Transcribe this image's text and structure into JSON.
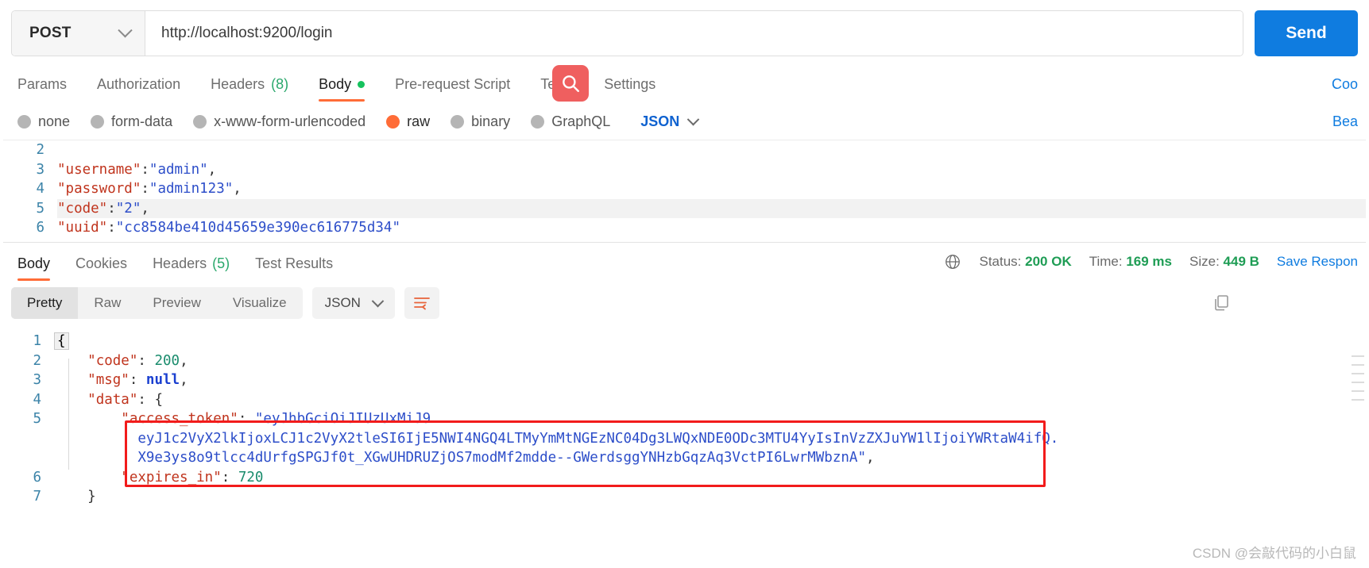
{
  "request": {
    "method": "POST",
    "method_icon": "chevron-down-icon",
    "url": "http://localhost:9200/login",
    "send_label": "Send",
    "tabs": [
      {
        "label": "Params",
        "active": false
      },
      {
        "label": "Authorization",
        "active": false
      },
      {
        "label": "Headers",
        "count": "(8)",
        "active": false
      },
      {
        "label": "Body",
        "dot": true,
        "active": true
      },
      {
        "label": "Pre-request Script",
        "active": false
      },
      {
        "label": "Tests",
        "active": false
      },
      {
        "label": "Settings",
        "active": false
      }
    ],
    "cookies_link": "Coo",
    "body_types": [
      {
        "label": "none",
        "selected": false
      },
      {
        "label": "form-data",
        "selected": false
      },
      {
        "label": "x-www-form-urlencoded",
        "selected": false
      },
      {
        "label": "raw",
        "selected": true
      },
      {
        "label": "binary",
        "selected": false
      },
      {
        "label": "GraphQL",
        "selected": false
      }
    ],
    "format_selected": "JSON",
    "beautify_link": "Bea",
    "body_lines": [
      {
        "num": "2",
        "tokens": []
      },
      {
        "num": "3",
        "tokens": [
          {
            "t": "\"username\"",
            "c": "k"
          },
          {
            "t": ":",
            "c": "p"
          },
          {
            "t": "\"admin\"",
            "c": "s"
          },
          {
            "t": ",",
            "c": "p"
          }
        ]
      },
      {
        "num": "4",
        "tokens": [
          {
            "t": "\"password\"",
            "c": "k"
          },
          {
            "t": ":",
            "c": "p"
          },
          {
            "t": "\"admin123\"",
            "c": "s"
          },
          {
            "t": ",",
            "c": "p"
          }
        ]
      },
      {
        "num": "5",
        "highlight": true,
        "tokens": [
          {
            "t": "\"code\"",
            "c": "k"
          },
          {
            "t": ":",
            "c": "p"
          },
          {
            "t": "\"2\"",
            "c": "s"
          },
          {
            "t": ",",
            "c": "p"
          }
        ]
      },
      {
        "num": "6",
        "tokens": [
          {
            "t": "\"uuid\"",
            "c": "k"
          },
          {
            "t": ":",
            "c": "p"
          },
          {
            "t": "\"cc8584be410d45659e390ec616775d34\"",
            "c": "s"
          }
        ]
      }
    ]
  },
  "response": {
    "tabs": [
      {
        "label": "Body",
        "active": true
      },
      {
        "label": "Cookies",
        "active": false
      },
      {
        "label": "Headers",
        "count": "(5)",
        "active": false
      },
      {
        "label": "Test Results",
        "active": false
      }
    ],
    "status": {
      "globe_icon": "globe-icon",
      "status_label": "Status:",
      "status_value": "200 OK",
      "time_label": "Time:",
      "time_value": "169 ms",
      "size_label": "Size:",
      "size_value": "449 B"
    },
    "save_response": "Save Respon",
    "view_modes": [
      {
        "label": "Pretty",
        "active": true
      },
      {
        "label": "Raw",
        "active": false
      },
      {
        "label": "Preview",
        "active": false
      },
      {
        "label": "Visualize",
        "active": false
      }
    ],
    "format_selected": "JSON",
    "wrap_icon": "word-wrap-icon",
    "copy_icon": "copy-icon",
    "body_lines": [
      {
        "num": "1",
        "tokens": [
          {
            "t": "{",
            "c": "brace"
          }
        ]
      },
      {
        "num": "2",
        "indent": 4,
        "tokens": [
          {
            "t": "\"code\"",
            "c": "k"
          },
          {
            "t": ": ",
            "c": "p"
          },
          {
            "t": "200",
            "c": "n"
          },
          {
            "t": ",",
            "c": "p"
          }
        ]
      },
      {
        "num": "3",
        "indent": 4,
        "tokens": [
          {
            "t": "\"msg\"",
            "c": "k"
          },
          {
            "t": ": ",
            "c": "p"
          },
          {
            "t": "null",
            "c": "nul"
          },
          {
            "t": ",",
            "c": "p"
          }
        ]
      },
      {
        "num": "4",
        "indent": 4,
        "tokens": [
          {
            "t": "\"data\"",
            "c": "k"
          },
          {
            "t": ": {",
            "c": "p"
          }
        ]
      },
      {
        "num": "5",
        "indent": 8,
        "tokens": [
          {
            "t": "\"access_token\"",
            "c": "k"
          },
          {
            "t": ": ",
            "c": "p"
          },
          {
            "t": "\"eyJhbGciOiJIUzUxMiJ9.",
            "c": "s"
          }
        ]
      },
      {
        "num": "",
        "indent": 10,
        "tokens": [
          {
            "t": "eyJ1c2VyX2lkIjoxLCJ1c2VyX2tleSI6IjE5NWI4NGQ4LTMyYmMtNGEzNC04Dg3LWQxNDE0ODc3MTU4YyIsInVzZXJuYW1lIjoiYWRtaW4ifQ.",
            "c": "s"
          }
        ]
      },
      {
        "num": "",
        "indent": 10,
        "tokens": [
          {
            "t": "X9e3ys8o9tlcc4dUrfgSPGJf0t_XGwUHDRUZjOS7modMf2mdde--GWerdsggYNHzbGqzAq3VctPI6LwrMWbznA\"",
            "c": "s"
          },
          {
            "t": ",",
            "c": "p"
          }
        ]
      },
      {
        "num": "6",
        "indent": 8,
        "tokens": [
          {
            "t": "\"expires_in\"",
            "c": "k"
          },
          {
            "t": ": ",
            "c": "p"
          },
          {
            "t": "720",
            "c": "n"
          }
        ]
      },
      {
        "num": "7",
        "indent": 4,
        "tokens": [
          {
            "t": "}",
            "c": "p"
          }
        ]
      }
    ]
  },
  "annotation": {
    "highlight_box": true,
    "box_color": "#f21b1b"
  },
  "search_overlay": {
    "icon": "search-icon",
    "color": "#ef5f5f"
  },
  "watermark": "CSDN @会敲代码的小白鼠"
}
